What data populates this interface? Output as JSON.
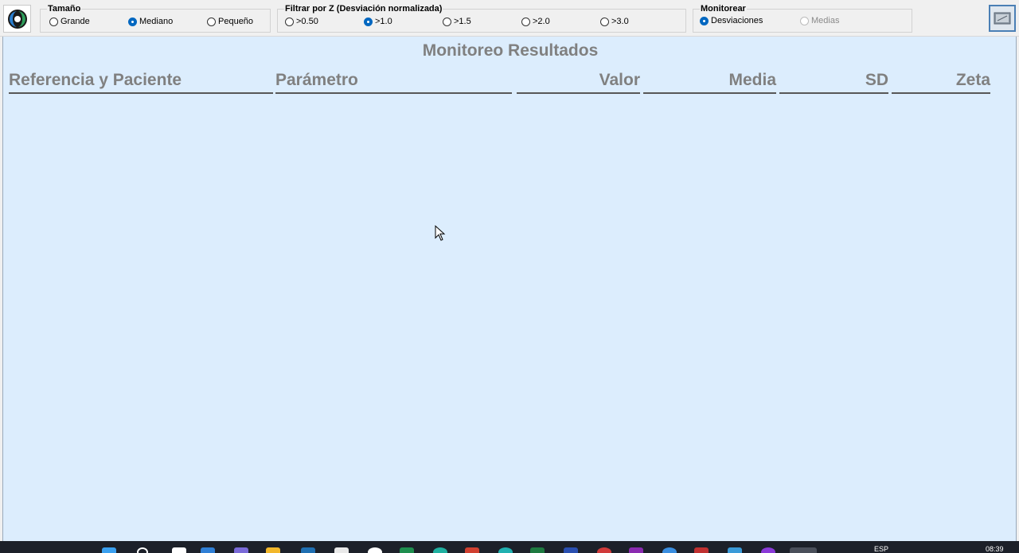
{
  "toolbar": {
    "logo_icon": "app-logo-icon",
    "size_group": {
      "title": "Tamaño",
      "options": [
        {
          "label": "Grande",
          "selected": false
        },
        {
          "label": "Mediano",
          "selected": true
        },
        {
          "label": "Pequeño",
          "selected": false
        }
      ]
    },
    "filter_group": {
      "title": "Filtrar por Z (Desviación normalizada)",
      "options": [
        {
          "label": ">0.50",
          "selected": false
        },
        {
          "label": ">1.0",
          "selected": true
        },
        {
          "label": ">1.5",
          "selected": false
        },
        {
          "label": ">2.0",
          "selected": false
        },
        {
          "label": ">3.0",
          "selected": false
        }
      ]
    },
    "monitor_group": {
      "title": "Monitorear",
      "options": [
        {
          "label": "Desviaciones",
          "selected": true,
          "enabled": true
        },
        {
          "label": "Medias",
          "selected": false,
          "enabled": false
        }
      ]
    },
    "corner_button_icon": "window-screen-icon"
  },
  "main": {
    "title": "Monitoreo Resultados",
    "columns": {
      "reference": "Referencia y Paciente",
      "parameter": "Parámetro",
      "value": "Valor",
      "mean": "Media",
      "sd": "SD",
      "zeta": "Zeta"
    },
    "rows": []
  },
  "taskbar": {
    "language": "ESP",
    "time": "08:39"
  },
  "colors": {
    "panel_background": "#dcedfd",
    "header_text": "#808080",
    "accent": "#0067c0",
    "taskbar": "#1c2029"
  }
}
